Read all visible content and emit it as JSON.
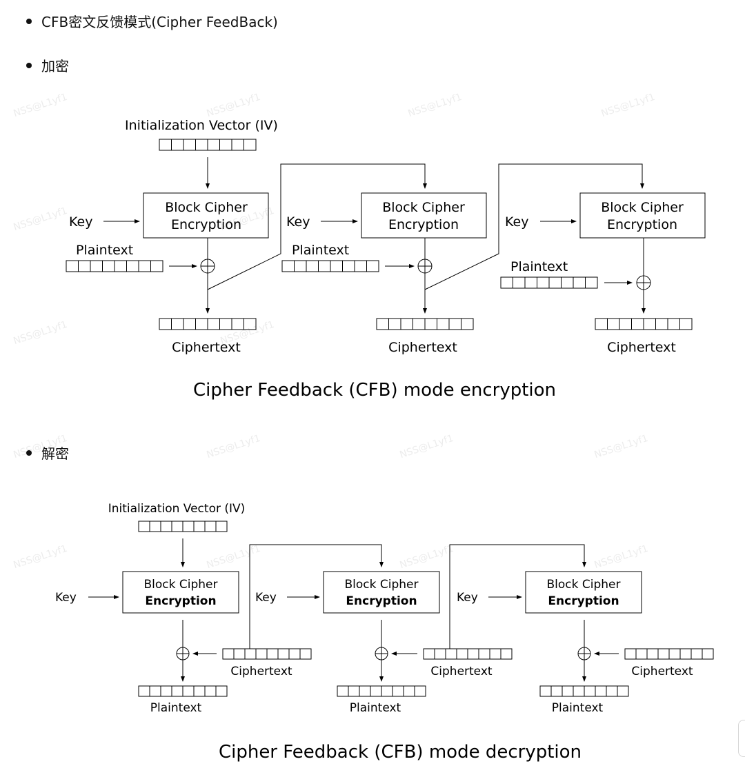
{
  "bullets": {
    "cfb_title": "CFB密文反馈模式(Cipher FeedBack)",
    "encrypt": "加密",
    "decrypt": "解密"
  },
  "encryption": {
    "iv_label": "Initialization Vector (IV)",
    "block_line1": "Block Cipher",
    "block_line2": "Encryption",
    "key_label": "Key",
    "plaintext_label": "Plaintext",
    "ciphertext_label": "Ciphertext",
    "caption": "Cipher Feedback (CFB) mode encryption"
  },
  "decryption": {
    "iv_label": "Initialization Vector (IV)",
    "block_line1": "Block Cipher",
    "block_line2": "Encryption",
    "key_label": "Key",
    "ciphertext_label": "Ciphertext",
    "plaintext_label": "Plaintext",
    "caption": "Cipher Feedback (CFB) mode decryption"
  },
  "watermark": "NSS@L1yf1"
}
